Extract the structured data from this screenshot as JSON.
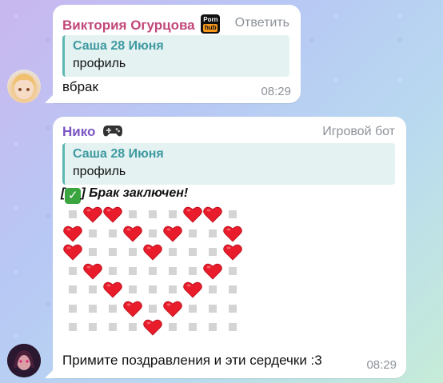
{
  "messages": [
    {
      "sender": "Виктория Огурцова",
      "sender_color": "#c2477a",
      "badge": {
        "top": "Porn",
        "bottom": "hub"
      },
      "action": "Ответить",
      "quote": {
        "author": "Саша 28 Июня",
        "text": "профиль"
      },
      "text": "вбрак",
      "time": "08:29",
      "avatar": "anime-girl-avatar"
    },
    {
      "sender": "Нико",
      "sender_color": "#7b55c2",
      "sender_icon": "gamepad-icon",
      "tag": "Игровой бот",
      "quote": {
        "author": "Саша 28 Июня",
        "text": "профиль"
      },
      "status_prefix": "[",
      "status_check": "✓",
      "status_text": "] Брак заключен!",
      "heart_grid": [
        "_HH__HH_",
        "H__H_H__H",
        "H____H___H",
        "_H____H_",
        "__H__H__",
        "___H_H__",
        "____H___"
      ],
      "footer": "Примите поздравления и эти сердечки :3",
      "time": "08:29",
      "avatar": "dark-haired-girl-avatar"
    }
  ],
  "heart_rows": [
    [
      0,
      1,
      1,
      0,
      0,
      0,
      1,
      1,
      0
    ],
    [
      1,
      0,
      0,
      1,
      0,
      1,
      0,
      0,
      1
    ],
    [
      1,
      0,
      0,
      0,
      1,
      0,
      0,
      0,
      1
    ],
    [
      0,
      1,
      0,
      0,
      0,
      0,
      0,
      1,
      0
    ],
    [
      0,
      0,
      1,
      0,
      0,
      0,
      1,
      0,
      0
    ],
    [
      0,
      0,
      0,
      1,
      0,
      1,
      0,
      0,
      0
    ],
    [
      0,
      0,
      0,
      0,
      1,
      0,
      0,
      0,
      0
    ]
  ]
}
